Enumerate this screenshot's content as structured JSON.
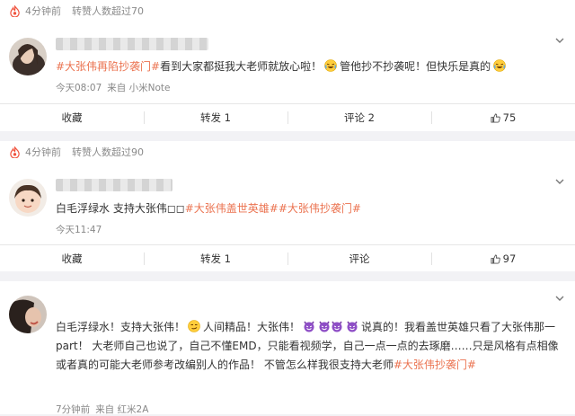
{
  "posts": [
    {
      "hot": {
        "time": "4分钟前",
        "label": "转赞人数超过70"
      },
      "text": {
        "hashtag": "#大张伟再陷抄袭门#",
        "part1": "看到大家都挺我大老师就放心啦！",
        "part2": "管他抄不抄袭呢！但快乐是真的"
      },
      "meta": {
        "time": "今天08:07",
        "source": "来自 小米Note"
      },
      "actions": {
        "collect": "收藏",
        "repost": "转发 1",
        "comment": "评论 2",
        "like": "75"
      }
    },
    {
      "hot": {
        "time": "4分钟前",
        "label": "转赞人数超过90"
      },
      "text": {
        "part1": "白毛浮绿水 支持大张伟◻◻",
        "tag1": "#大张伟盖世英雄#",
        "tag2": "#大张伟抄袭门#"
      },
      "meta": {
        "time": "今天11:47"
      },
      "actions": {
        "collect": "收藏",
        "repost": "转发 1",
        "comment": "评论",
        "like": "97"
      }
    },
    {
      "text": {
        "part1": "白毛浮绿水！支持大张伟！",
        "part2": "人间精品！大张伟！",
        "part3": "说真的！我看盖世英雄只看了大张伟那一part！ 大老师自己也说了，自己不懂EMD，只能看视频学，自己一点一点的去琢磨……只是风格有点相像或者真的可能大老师参考改编别人的作品！ 不管怎么样我很支持大老师",
        "tag": "#大张伟抄袭门#"
      },
      "meta": {
        "time": "7分钟前",
        "source": "来自 红米2A"
      }
    }
  ],
  "colors": {
    "link": "#eb7350",
    "muted": "#888888",
    "background": "#f2f2f5"
  },
  "icons": [
    "fire-icon",
    "chevron-down-icon",
    "laugh-cry-emoji",
    "devil-emoji",
    "smirk-emoji",
    "thumbs-up-icon"
  ]
}
